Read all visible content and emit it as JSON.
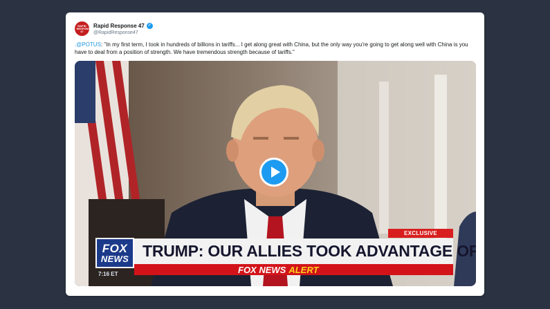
{
  "tweet": {
    "author": {
      "display_name": "Rapid Response 47",
      "handle": "@RapidResponse47",
      "avatar_text": "RAPID RESPONSE 47",
      "verified_icon": "verified-badge-icon"
    },
    "mention": ".@POTUS",
    "text": ": \"In my first term, I took in hundreds of billions in tariffs... I get along great with China, but the only way you're going to get along well with China is you have to deal from a position of strength. We have tremendous strength because of tariffs.\""
  },
  "video": {
    "play_icon": "play-icon",
    "exclusive_label": "EXCLUSIVE",
    "headline": "TRUMP: OUR ALLIES TOOK ADVANTAGE OF US",
    "alert_brand": "FOX NEWS",
    "alert_word": "ALERT",
    "logo_top": "FOX",
    "logo_bottom": "NEWS",
    "timecode": "7:16 ET"
  },
  "colors": {
    "page_background": "#2b3342",
    "card": "#ffffff",
    "link": "#1b95e0",
    "play": "#1d9bf0",
    "alert_red": "#d2141a",
    "alert_yellow": "#ffd21f",
    "fox_blue": "#1b3a8a"
  }
}
